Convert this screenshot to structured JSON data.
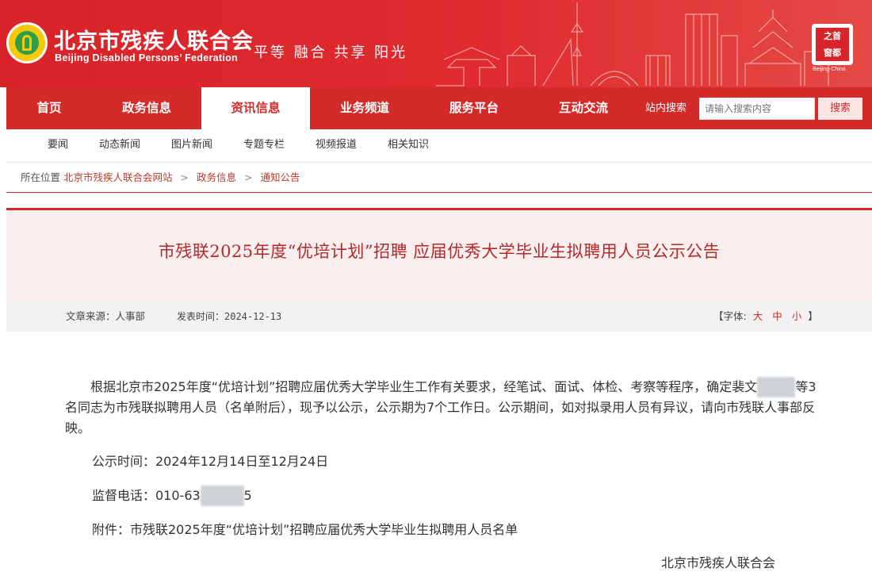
{
  "header": {
    "org_cn": "北京市残疾人联合会",
    "org_en": "Beijing Disabled Persons’ Federation",
    "slogan": "平等 融合 共享 阳光",
    "seal_text": [
      "之",
      "首",
      "窗",
      "都"
    ],
    "seal_en": "Beijing-China",
    "colors": {
      "brand_red": "#d8232a",
      "logo_yellow": "#f6c90e",
      "logo_green": "#2f9e44"
    }
  },
  "nav": {
    "items": [
      "首页",
      "政务信息",
      "资讯信息",
      "业务频道",
      "服务平台",
      "互动交流"
    ],
    "active_index": 2,
    "search_label": "站内搜索",
    "search_placeholder": "请输入搜索内容",
    "search_button": "搜索"
  },
  "subnav": {
    "items": [
      "要闻",
      "动态新闻",
      "图片新闻",
      "专题专栏",
      "视频报道",
      "相关知识"
    ]
  },
  "breadcrumb": {
    "prefix": "所在位置",
    "items": [
      "北京市残疾人联合会网站",
      "政务信息",
      "通知公告"
    ],
    "separator": ">"
  },
  "article": {
    "title": "市残联2025年度“优培计划”招聘 应届优秀大学毕业生拟聘用人员公示公告",
    "source": "文章来源：人事部",
    "published": "发表时间：2024-12-13",
    "font_label": "【字体:",
    "font_sizes": [
      "大",
      "中",
      "小"
    ],
    "font_close": "】",
    "para_1a": "根据北京市2025年度“优培计划”招聘应届优秀大学毕业生工作有关要求，经笔试、面试、体检、考察等程序，确定裴文",
    "para_1b": "等3名同志为市残联拟聘用人员（名单附后），现予以公示，公示期为7个工作日。公示期间，如对拟录用人员有异议，请向市残联人事部反映。",
    "period": "公示时间：2024年12月14日至12月24日",
    "phone_prefix": "监督电话：010-63",
    "phone_suffix": "5",
    "attachment": "附件：市残联2025年度“优培计划”招聘应届优秀大学毕业生拟聘用人员名单",
    "signature": "北京市残疾人联合会"
  }
}
